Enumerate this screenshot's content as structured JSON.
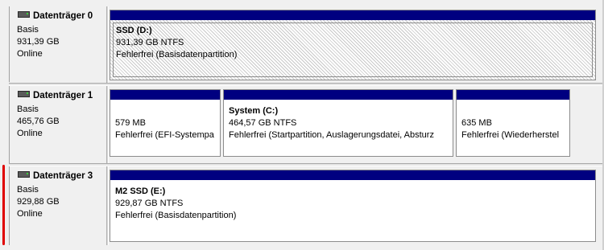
{
  "disks": [
    {
      "name": "Datenträger 0",
      "type": "Basis",
      "size": "931,39 GB",
      "status": "Online",
      "partitions": [
        {
          "label": "SSD  (D:)",
          "size_fs": "931,39 GB NTFS",
          "state": "Fehlerfrei (Basisdatenpartition)",
          "selected": true
        }
      ]
    },
    {
      "name": "Datenträger 1",
      "type": "Basis",
      "size": "465,76 GB",
      "status": "Online",
      "partitions": [
        {
          "label": "",
          "size_fs": "579 MB",
          "state": "Fehlerfrei (EFI-Systempa",
          "selected": false
        },
        {
          "label": "System  (C:)",
          "size_fs": "464,57 GB NTFS",
          "state": "Fehlerfrei (Startpartition, Auslagerungsdatei, Absturz",
          "selected": false
        },
        {
          "label": "",
          "size_fs": "635 MB",
          "state": "Fehlerfrei (Wiederherstel",
          "selected": false
        }
      ]
    },
    {
      "name": "Datenträger 3",
      "type": "Basis",
      "size": "929,88 GB",
      "status": "Online",
      "partitions": [
        {
          "label": "M2 SSD  (E:)",
          "size_fs": "929,87 GB NTFS",
          "state": "Fehlerfrei (Basisdatenpartition)",
          "selected": false
        }
      ]
    }
  ],
  "colors": {
    "partition_bar": "#000080",
    "annotation_mark": "#e00000"
  },
  "icons": {
    "disk": "disk-drive-icon"
  }
}
